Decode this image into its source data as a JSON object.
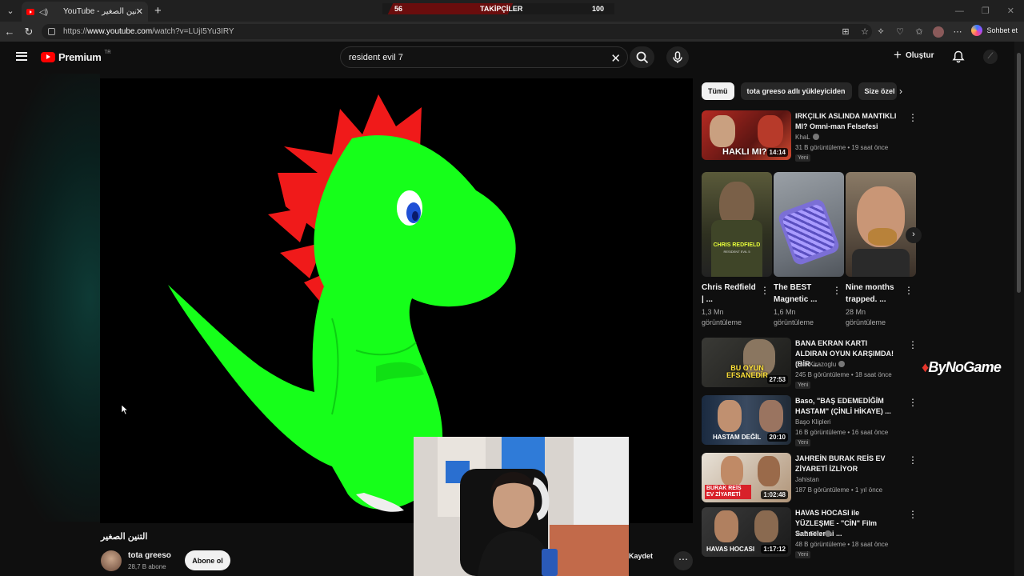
{
  "browser": {
    "tab_title": "YouTube - التنين الصغير",
    "url_prefix": "https://",
    "url_domain": "www.youtube.com",
    "url_path": "/watch?v=LUjI5Yu3IRY",
    "copilot_label": "Sohbet et",
    "follower_goal": {
      "current": "56",
      "label": "TAKİPÇİLER",
      "target": "100"
    }
  },
  "header": {
    "logo_text": "Premium",
    "region": "TR",
    "search_value": "resident evil 7",
    "create_label": "Oluştur"
  },
  "video": {
    "title": "التنين الصغير",
    "channel": "tota greeso",
    "subscribers": "28,7 B abone",
    "subscribe_label": "Abone ol",
    "save_label": "Kaydet"
  },
  "chips": [
    "Tümü",
    "tota greeso adlı yükleyiciden",
    "Size özel"
  ],
  "recommendations": [
    {
      "title": "IRKÇILIK ASLINDA MANTIKLI MI? Omni-man Felsefesi",
      "channel": "KhaL",
      "meta": "31 B görüntüleme • 19 saat önce",
      "badge": "Yeni",
      "duration": "14:14"
    },
    {
      "title": "BANA EKRAN KARTI ALDIRAN OYUN KARŞIMDA! (BİR ...",
      "channel": "Enis Kirazoglu",
      "meta": "245 B görüntüleme • 18 saat önce",
      "badge": "Yeni",
      "duration": "27:53"
    },
    {
      "title": "Baso, \"BAŞ EDEMEDİĞİM HASTAM\" (ÇİNLİ HİKAYE) ...",
      "channel": "Başo Klipleri",
      "meta": "16 B görüntüleme • 16 saat önce",
      "badge": "Yeni",
      "duration": "20:10"
    },
    {
      "title": "JAHREİN BURAK REİS EV ZİYARETİ İZLİYOR",
      "channel": "Jahistan",
      "meta": "187 B görüntüleme • 1 yıl önce",
      "badge": "",
      "duration": "1:02:48"
    },
    {
      "title": "HAVAS HOCASI ile YÜZLEŞME - \"CİN\" Film Sahnelerini ...",
      "channel": "Yer6 Film",
      "meta": "48 B görüntüleme • 18 saat önce",
      "badge": "Yeni",
      "duration": "1:17:12"
    }
  ],
  "shorts": [
    {
      "title": "Chris Redfield | ...",
      "views": "1,3 Mn görüntüleme"
    },
    {
      "title": "The BEST Magnetic ...",
      "views": "1,6 Mn görüntüleme"
    },
    {
      "title": "Nine months trapped. ...",
      "views": "28 Mn görüntüleme"
    }
  ],
  "thumb_text": {
    "rec0": "HAKLI MI?",
    "rec1": "BU OYUN EFSANEDİR",
    "rec2": "HASTAM DEĞİL",
    "rec3": "BURAK REİS EV ZİYARETİ",
    "rec4": "HAVAS HOCASI",
    "short0": "CHRIS REDFIELD",
    "short0_sub": "RESIDENT EVIL 5"
  },
  "overlay": {
    "brand_a": "By",
    "brand_b": "NoGame"
  },
  "colors": {
    "youtube_red": "#ff0000",
    "dino_green": "#16ff1a",
    "dino_spikes": "#f01a1a",
    "background": "#0f0f0f"
  }
}
